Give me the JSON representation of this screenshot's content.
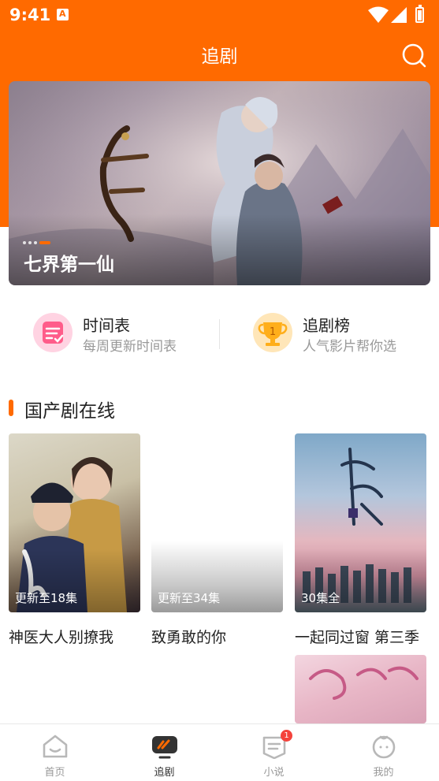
{
  "status_bar": {
    "time": "9:41"
  },
  "header": {
    "title": "追剧"
  },
  "banner": {
    "title": "七界第一仙",
    "dots_total": 4,
    "active_dot": 4
  },
  "shortcuts": [
    {
      "title": "时间表",
      "subtitle": "每周更新时间表"
    },
    {
      "title": "追剧榜",
      "subtitle": "人气影片帮你选"
    }
  ],
  "section": {
    "title": "国产剧在线",
    "cards": [
      {
        "caption": "更新至18集",
        "name": "神医大人别撩我"
      },
      {
        "caption": "更新至34集",
        "name": "致勇敢的你"
      },
      {
        "caption": "30集全",
        "name": "一起同过窗 第三季"
      }
    ]
  },
  "bottom_nav": {
    "items": [
      {
        "label": "首页"
      },
      {
        "label": "追剧"
      },
      {
        "label": "小说",
        "badge": "1"
      },
      {
        "label": "我的"
      }
    ]
  },
  "colors": {
    "accent": "#ff6a00",
    "badge": "#f4433c"
  }
}
